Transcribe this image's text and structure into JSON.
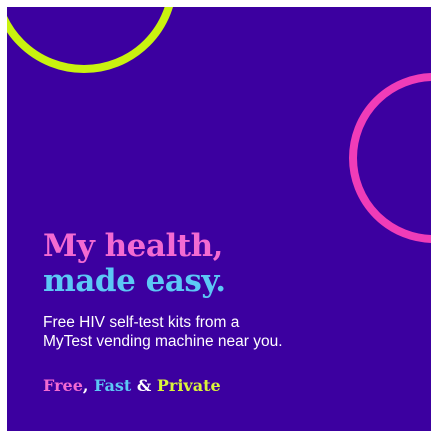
{
  "colors": {
    "background": "#3c00a0",
    "ring_green": "#c9f20f",
    "ring_pink": "#f03cb8",
    "headline_line1": "#f36ad2",
    "headline_line2": "#5cc8f5",
    "body_text": "#ffffff",
    "tag_free": "#f36ad2",
    "tag_fast": "#5cc8f5",
    "tag_private": "#d9f53a",
    "tag_punct": "#ffffff"
  },
  "headline": {
    "line1": "My health,",
    "line2": "made easy."
  },
  "subtext": {
    "line1": "Free HIV self-test kits from a",
    "line2": "MyTest vending machine near you."
  },
  "tagline": {
    "free": "Free",
    "comma": ", ",
    "fast": "Fast",
    "amp": " & ",
    "private": "Private"
  }
}
